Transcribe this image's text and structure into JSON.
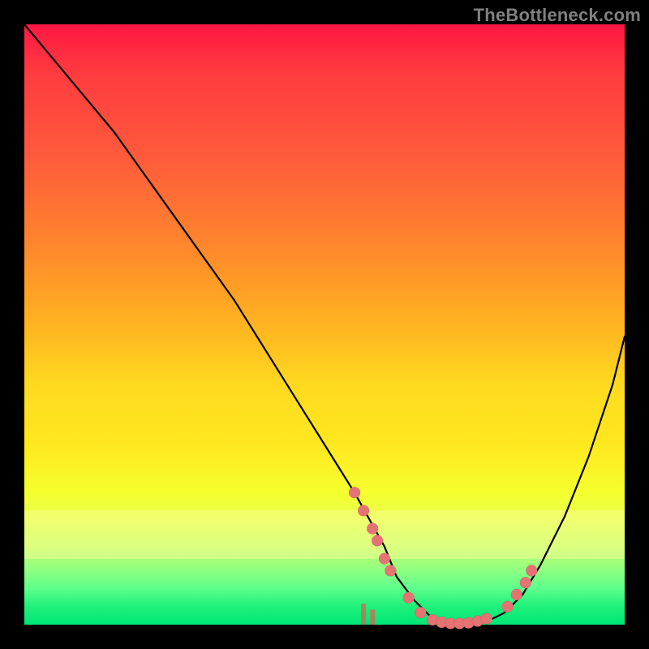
{
  "watermark": "TheBottleneck.com",
  "colors": {
    "dot": "#e57373",
    "curve": "#000000",
    "gradient_top": "#ff1744",
    "gradient_bottom": "#00e676"
  },
  "chart_data": {
    "type": "line",
    "title": "",
    "xlabel": "",
    "ylabel": "",
    "xlim": [
      0,
      100
    ],
    "ylim": [
      0,
      100
    ],
    "series": [
      {
        "name": "bottleneck-curve",
        "x": [
          0,
          5,
          10,
          15,
          20,
          25,
          30,
          35,
          40,
          45,
          50,
          55,
          60,
          62,
          65,
          68,
          70,
          72,
          75,
          78,
          80,
          83,
          86,
          90,
          94,
          98,
          100
        ],
        "y": [
          100,
          94,
          88,
          82,
          75,
          68,
          61,
          54,
          46,
          38,
          30,
          22,
          13,
          8,
          4,
          1,
          0,
          0,
          0,
          1,
          2,
          5,
          10,
          18,
          28,
          40,
          48
        ]
      }
    ],
    "scatter_points": {
      "name": "highlighted-points",
      "points": [
        {
          "x": 55.0,
          "y": 22.0
        },
        {
          "x": 56.5,
          "y": 19.0
        },
        {
          "x": 58.0,
          "y": 16.0
        },
        {
          "x": 58.8,
          "y": 14.0
        },
        {
          "x": 60.0,
          "y": 11.0
        },
        {
          "x": 61.0,
          "y": 9.0
        },
        {
          "x": 64.0,
          "y": 4.5
        },
        {
          "x": 66.0,
          "y": 2.0
        },
        {
          "x": 68.0,
          "y": 0.8
        },
        {
          "x": 69.5,
          "y": 0.4
        },
        {
          "x": 71.0,
          "y": 0.2
        },
        {
          "x": 72.5,
          "y": 0.2
        },
        {
          "x": 74.0,
          "y": 0.3
        },
        {
          "x": 75.5,
          "y": 0.6
        },
        {
          "x": 77.0,
          "y": 1.0
        },
        {
          "x": 80.5,
          "y": 3.0
        },
        {
          "x": 82.0,
          "y": 5.0
        },
        {
          "x": 83.5,
          "y": 7.0
        },
        {
          "x": 84.5,
          "y": 9.0
        }
      ]
    },
    "mini_bars": {
      "name": "cluster-bars",
      "bars": [
        {
          "x": 56.5,
          "h": 3.5
        },
        {
          "x": 58.0,
          "h": 2.5
        },
        {
          "x": 68.0,
          "h": 1.2
        },
        {
          "x": 69.5,
          "h": 1.0
        },
        {
          "x": 71.0,
          "h": 0.8
        },
        {
          "x": 72.5,
          "h": 0.8
        },
        {
          "x": 74.0,
          "h": 0.9
        },
        {
          "x": 75.5,
          "h": 1.0
        }
      ]
    },
    "pale_band": {
      "y_bottom": 11,
      "y_top": 19
    }
  }
}
